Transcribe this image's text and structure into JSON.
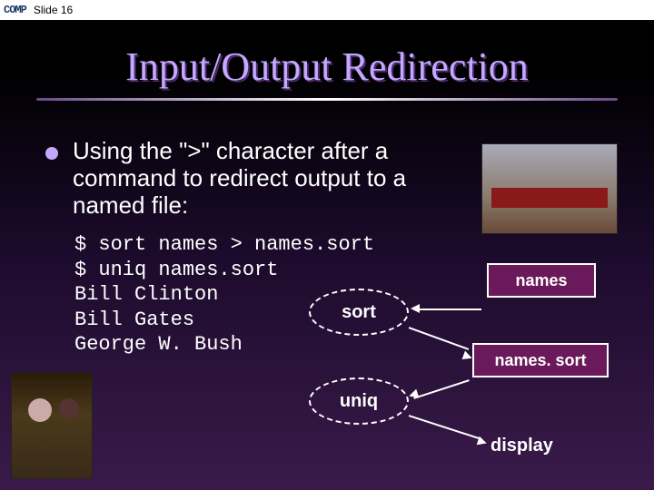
{
  "topbar": {
    "logo": "COMP",
    "slide_label": "Slide 16"
  },
  "title": "Input/Output Redirection",
  "bullet": "Using the \">\" character after a command to redirect output to a named file:",
  "code": {
    "l1": "$ sort names > names.sort",
    "l2": "$ uniq names.sort",
    "l3": "Bill Clinton",
    "l4": "Bill Gates",
    "l5": "George W. Bush"
  },
  "diagram": {
    "sort": "sort",
    "uniq": "uniq",
    "names": "names",
    "names_sort": "names. sort",
    "display": "display"
  }
}
